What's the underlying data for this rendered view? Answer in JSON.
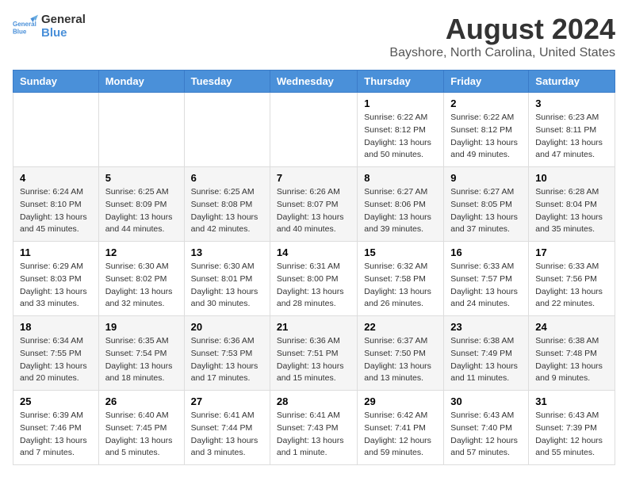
{
  "header": {
    "logo_line1": "General",
    "logo_line2": "Blue",
    "title": "August 2024",
    "subtitle": "Bayshore, North Carolina, United States"
  },
  "weekdays": [
    "Sunday",
    "Monday",
    "Tuesday",
    "Wednesday",
    "Thursday",
    "Friday",
    "Saturday"
  ],
  "weeks": [
    [
      {
        "day": "",
        "info": ""
      },
      {
        "day": "",
        "info": ""
      },
      {
        "day": "",
        "info": ""
      },
      {
        "day": "",
        "info": ""
      },
      {
        "day": "1",
        "info": "Sunrise: 6:22 AM\nSunset: 8:12 PM\nDaylight: 13 hours\nand 50 minutes."
      },
      {
        "day": "2",
        "info": "Sunrise: 6:22 AM\nSunset: 8:12 PM\nDaylight: 13 hours\nand 49 minutes."
      },
      {
        "day": "3",
        "info": "Sunrise: 6:23 AM\nSunset: 8:11 PM\nDaylight: 13 hours\nand 47 minutes."
      }
    ],
    [
      {
        "day": "4",
        "info": "Sunrise: 6:24 AM\nSunset: 8:10 PM\nDaylight: 13 hours\nand 45 minutes."
      },
      {
        "day": "5",
        "info": "Sunrise: 6:25 AM\nSunset: 8:09 PM\nDaylight: 13 hours\nand 44 minutes."
      },
      {
        "day": "6",
        "info": "Sunrise: 6:25 AM\nSunset: 8:08 PM\nDaylight: 13 hours\nand 42 minutes."
      },
      {
        "day": "7",
        "info": "Sunrise: 6:26 AM\nSunset: 8:07 PM\nDaylight: 13 hours\nand 40 minutes."
      },
      {
        "day": "8",
        "info": "Sunrise: 6:27 AM\nSunset: 8:06 PM\nDaylight: 13 hours\nand 39 minutes."
      },
      {
        "day": "9",
        "info": "Sunrise: 6:27 AM\nSunset: 8:05 PM\nDaylight: 13 hours\nand 37 minutes."
      },
      {
        "day": "10",
        "info": "Sunrise: 6:28 AM\nSunset: 8:04 PM\nDaylight: 13 hours\nand 35 minutes."
      }
    ],
    [
      {
        "day": "11",
        "info": "Sunrise: 6:29 AM\nSunset: 8:03 PM\nDaylight: 13 hours\nand 33 minutes."
      },
      {
        "day": "12",
        "info": "Sunrise: 6:30 AM\nSunset: 8:02 PM\nDaylight: 13 hours\nand 32 minutes."
      },
      {
        "day": "13",
        "info": "Sunrise: 6:30 AM\nSunset: 8:01 PM\nDaylight: 13 hours\nand 30 minutes."
      },
      {
        "day": "14",
        "info": "Sunrise: 6:31 AM\nSunset: 8:00 PM\nDaylight: 13 hours\nand 28 minutes."
      },
      {
        "day": "15",
        "info": "Sunrise: 6:32 AM\nSunset: 7:58 PM\nDaylight: 13 hours\nand 26 minutes."
      },
      {
        "day": "16",
        "info": "Sunrise: 6:33 AM\nSunset: 7:57 PM\nDaylight: 13 hours\nand 24 minutes."
      },
      {
        "day": "17",
        "info": "Sunrise: 6:33 AM\nSunset: 7:56 PM\nDaylight: 13 hours\nand 22 minutes."
      }
    ],
    [
      {
        "day": "18",
        "info": "Sunrise: 6:34 AM\nSunset: 7:55 PM\nDaylight: 13 hours\nand 20 minutes."
      },
      {
        "day": "19",
        "info": "Sunrise: 6:35 AM\nSunset: 7:54 PM\nDaylight: 13 hours\nand 18 minutes."
      },
      {
        "day": "20",
        "info": "Sunrise: 6:36 AM\nSunset: 7:53 PM\nDaylight: 13 hours\nand 17 minutes."
      },
      {
        "day": "21",
        "info": "Sunrise: 6:36 AM\nSunset: 7:51 PM\nDaylight: 13 hours\nand 15 minutes."
      },
      {
        "day": "22",
        "info": "Sunrise: 6:37 AM\nSunset: 7:50 PM\nDaylight: 13 hours\nand 13 minutes."
      },
      {
        "day": "23",
        "info": "Sunrise: 6:38 AM\nSunset: 7:49 PM\nDaylight: 13 hours\nand 11 minutes."
      },
      {
        "day": "24",
        "info": "Sunrise: 6:38 AM\nSunset: 7:48 PM\nDaylight: 13 hours\nand 9 minutes."
      }
    ],
    [
      {
        "day": "25",
        "info": "Sunrise: 6:39 AM\nSunset: 7:46 PM\nDaylight: 13 hours\nand 7 minutes."
      },
      {
        "day": "26",
        "info": "Sunrise: 6:40 AM\nSunset: 7:45 PM\nDaylight: 13 hours\nand 5 minutes."
      },
      {
        "day": "27",
        "info": "Sunrise: 6:41 AM\nSunset: 7:44 PM\nDaylight: 13 hours\nand 3 minutes."
      },
      {
        "day": "28",
        "info": "Sunrise: 6:41 AM\nSunset: 7:43 PM\nDaylight: 13 hours\nand 1 minute."
      },
      {
        "day": "29",
        "info": "Sunrise: 6:42 AM\nSunset: 7:41 PM\nDaylight: 12 hours\nand 59 minutes."
      },
      {
        "day": "30",
        "info": "Sunrise: 6:43 AM\nSunset: 7:40 PM\nDaylight: 12 hours\nand 57 minutes."
      },
      {
        "day": "31",
        "info": "Sunrise: 6:43 AM\nSunset: 7:39 PM\nDaylight: 12 hours\nand 55 minutes."
      }
    ]
  ]
}
